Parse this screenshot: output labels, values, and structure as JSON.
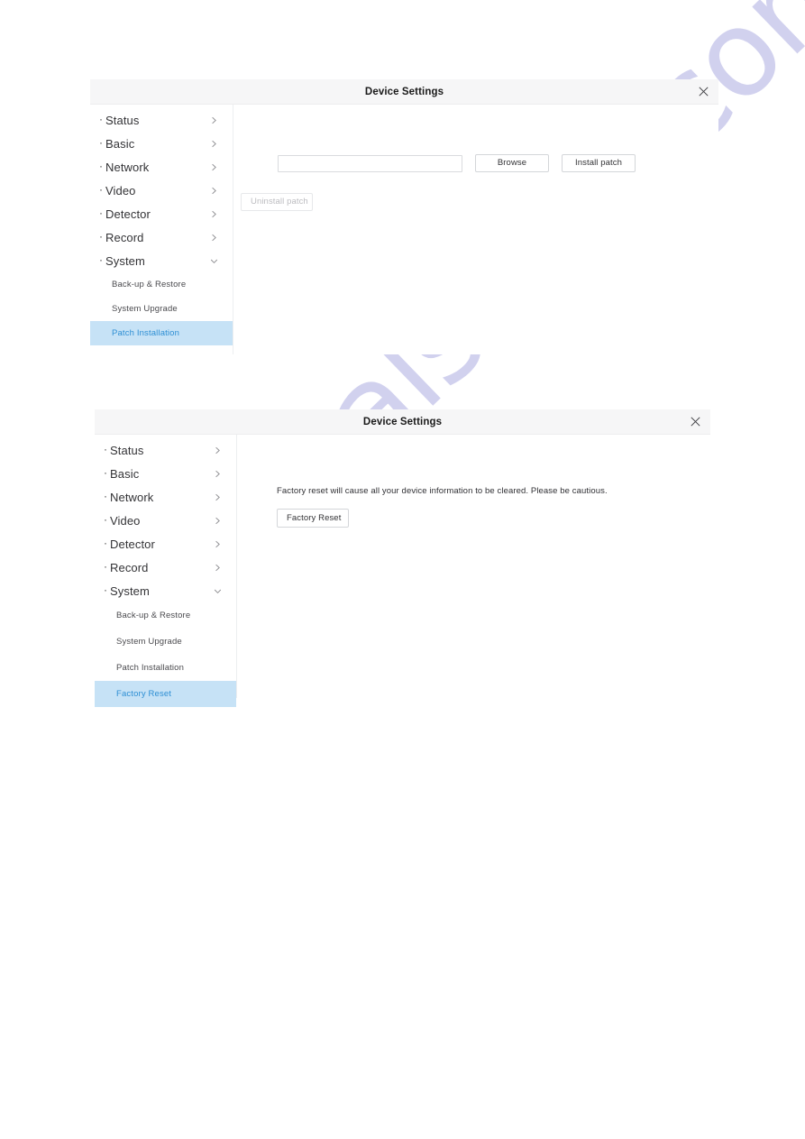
{
  "watermark": {
    "text": "manualshive.com",
    "color": "#cfcfee"
  },
  "panels": [
    {
      "id": "patch-installation",
      "header": {
        "title": "Device Settings",
        "close_icon": "close-icon"
      },
      "sidebar": {
        "items": [
          {
            "label": "Status",
            "bullet": "·",
            "chevron": "chevron-right-icon"
          },
          {
            "label": "Basic",
            "bullet": "·",
            "chevron": "chevron-right-icon"
          },
          {
            "label": "Network",
            "bullet": "·",
            "chevron": "chevron-right-icon"
          },
          {
            "label": "Video",
            "bullet": "·",
            "chevron": "chevron-right-icon"
          },
          {
            "label": "Detector",
            "bullet": "·",
            "chevron": "chevron-right-icon"
          },
          {
            "label": "Record",
            "bullet": "·",
            "chevron": "chevron-right-icon"
          },
          {
            "label": "System",
            "bullet": "·",
            "chevron": "chevron-down-icon"
          }
        ],
        "sub_items": [
          {
            "label": "Back-up & Restore",
            "active": false
          },
          {
            "label": "System Upgrade",
            "active": false
          },
          {
            "label": "Patch Installation",
            "active": true
          }
        ],
        "active_color": "#2e8fd4",
        "active_background": "#c6e2f6"
      },
      "content": {
        "file_input_value": "",
        "file_input_placeholder": "",
        "browse_label": "Browse",
        "install_label": "Install patch",
        "uninstall_label": "Uninstall patch",
        "uninstall_disabled": true
      }
    },
    {
      "id": "factory-reset",
      "header": {
        "title": "Device Settings",
        "close_icon": "close-icon"
      },
      "sidebar": {
        "items": [
          {
            "label": "Status",
            "bullet": "·",
            "chevron": "chevron-right-icon"
          },
          {
            "label": "Basic",
            "bullet": "·",
            "chevron": "chevron-right-icon"
          },
          {
            "label": "Network",
            "bullet": "·",
            "chevron": "chevron-right-icon"
          },
          {
            "label": "Video",
            "bullet": "·",
            "chevron": "chevron-right-icon"
          },
          {
            "label": "Detector",
            "bullet": "·",
            "chevron": "chevron-right-icon"
          },
          {
            "label": "Record",
            "bullet": "·",
            "chevron": "chevron-right-icon"
          },
          {
            "label": "System",
            "bullet": "·",
            "chevron": "chevron-down-icon"
          }
        ],
        "sub_items": [
          {
            "label": "Back-up & Restore",
            "active": false
          },
          {
            "label": "System Upgrade",
            "active": false
          },
          {
            "label": "Patch Installation",
            "active": false
          },
          {
            "label": "Factory Reset",
            "active": true
          }
        ],
        "active_color": "#2e8fd4",
        "active_background": "#c6e2f6"
      },
      "content": {
        "notice": "Factory reset will cause all your device information to be cleared. Please be cautious.",
        "factory_reset_label": "Factory Reset"
      }
    }
  ]
}
